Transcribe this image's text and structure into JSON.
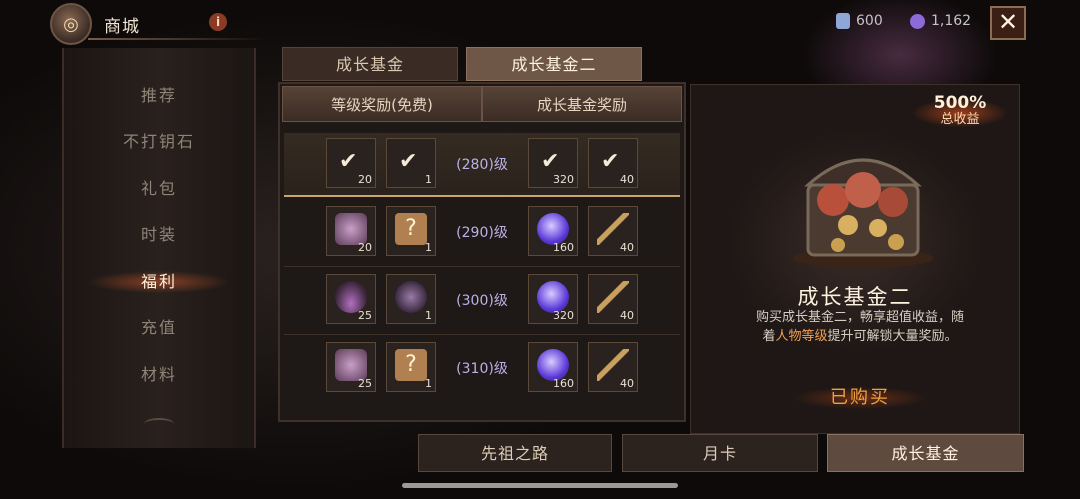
{
  "header": {
    "title": "商城",
    "info_label": "i",
    "close_label": "✕"
  },
  "currencies": [
    {
      "icon": "gem-card-icon",
      "value": "600",
      "color": "#8fa6d8"
    },
    {
      "icon": "purple-orb-icon",
      "value": "1,162",
      "color": "#8c6ad8"
    }
  ],
  "sidebar": {
    "items": [
      {
        "label": "推荐"
      },
      {
        "label": "不打钥石"
      },
      {
        "label": "礼包"
      },
      {
        "label": "时装"
      },
      {
        "label": "福利"
      },
      {
        "label": "充值"
      },
      {
        "label": "材料"
      }
    ],
    "active_index": 4
  },
  "top_tabs": [
    {
      "label": "成长基金"
    },
    {
      "label": "成长基金二"
    }
  ],
  "columns": {
    "free": "等级奖励(免费)",
    "paid": "成长基金奖励"
  },
  "rows": [
    {
      "level": "(280)级",
      "items": [
        {
          "icon": "claimed-item-icon",
          "count": "20",
          "claimed": "✔"
        },
        {
          "icon": "claimed-item-icon",
          "count": "1",
          "claimed": "✔"
        },
        {
          "icon": "claimed-orb-icon",
          "count": "320",
          "claimed": "✔"
        },
        {
          "icon": "claimed-key-icon",
          "count": "40",
          "claimed": "✔"
        }
      ]
    },
    {
      "level": "(290)级",
      "items": [
        {
          "icon": "pink-gem-icon",
          "count": "20"
        },
        {
          "icon": "mystery-scroll-icon",
          "count": "1"
        },
        {
          "icon": "purple-orb-icon",
          "count": "160"
        },
        {
          "icon": "gold-key-icon",
          "count": "40"
        }
      ]
    },
    {
      "level": "(300)级",
      "items": [
        {
          "icon": "potion-bowl-icon",
          "count": "25"
        },
        {
          "icon": "amulet-icon",
          "count": "1"
        },
        {
          "icon": "purple-orb-icon",
          "count": "320"
        },
        {
          "icon": "gold-key-icon",
          "count": "40"
        }
      ]
    },
    {
      "level": "(310)级",
      "items": [
        {
          "icon": "pink-gem-icon",
          "count": "25"
        },
        {
          "icon": "mystery-scroll-icon",
          "count": "1"
        },
        {
          "icon": "purple-orb-icon",
          "count": "160"
        },
        {
          "icon": "gold-key-icon",
          "count": "40"
        }
      ]
    }
  ],
  "detail": {
    "percent": "500%",
    "percent_label": "总收益",
    "title": "成长基金二",
    "desc_1": "购买成长基金二，畅享超值收益，随着",
    "desc_highlight": "人物等级",
    "desc_2": "提升可解锁大量奖励。",
    "status": "已购买"
  },
  "bottom_tabs": [
    {
      "label": "先祖之路"
    },
    {
      "label": "月卡"
    },
    {
      "label": "成长基金"
    }
  ],
  "colors": {
    "accent_orange": "#f0a040",
    "level_text": "#b9b2e6"
  }
}
